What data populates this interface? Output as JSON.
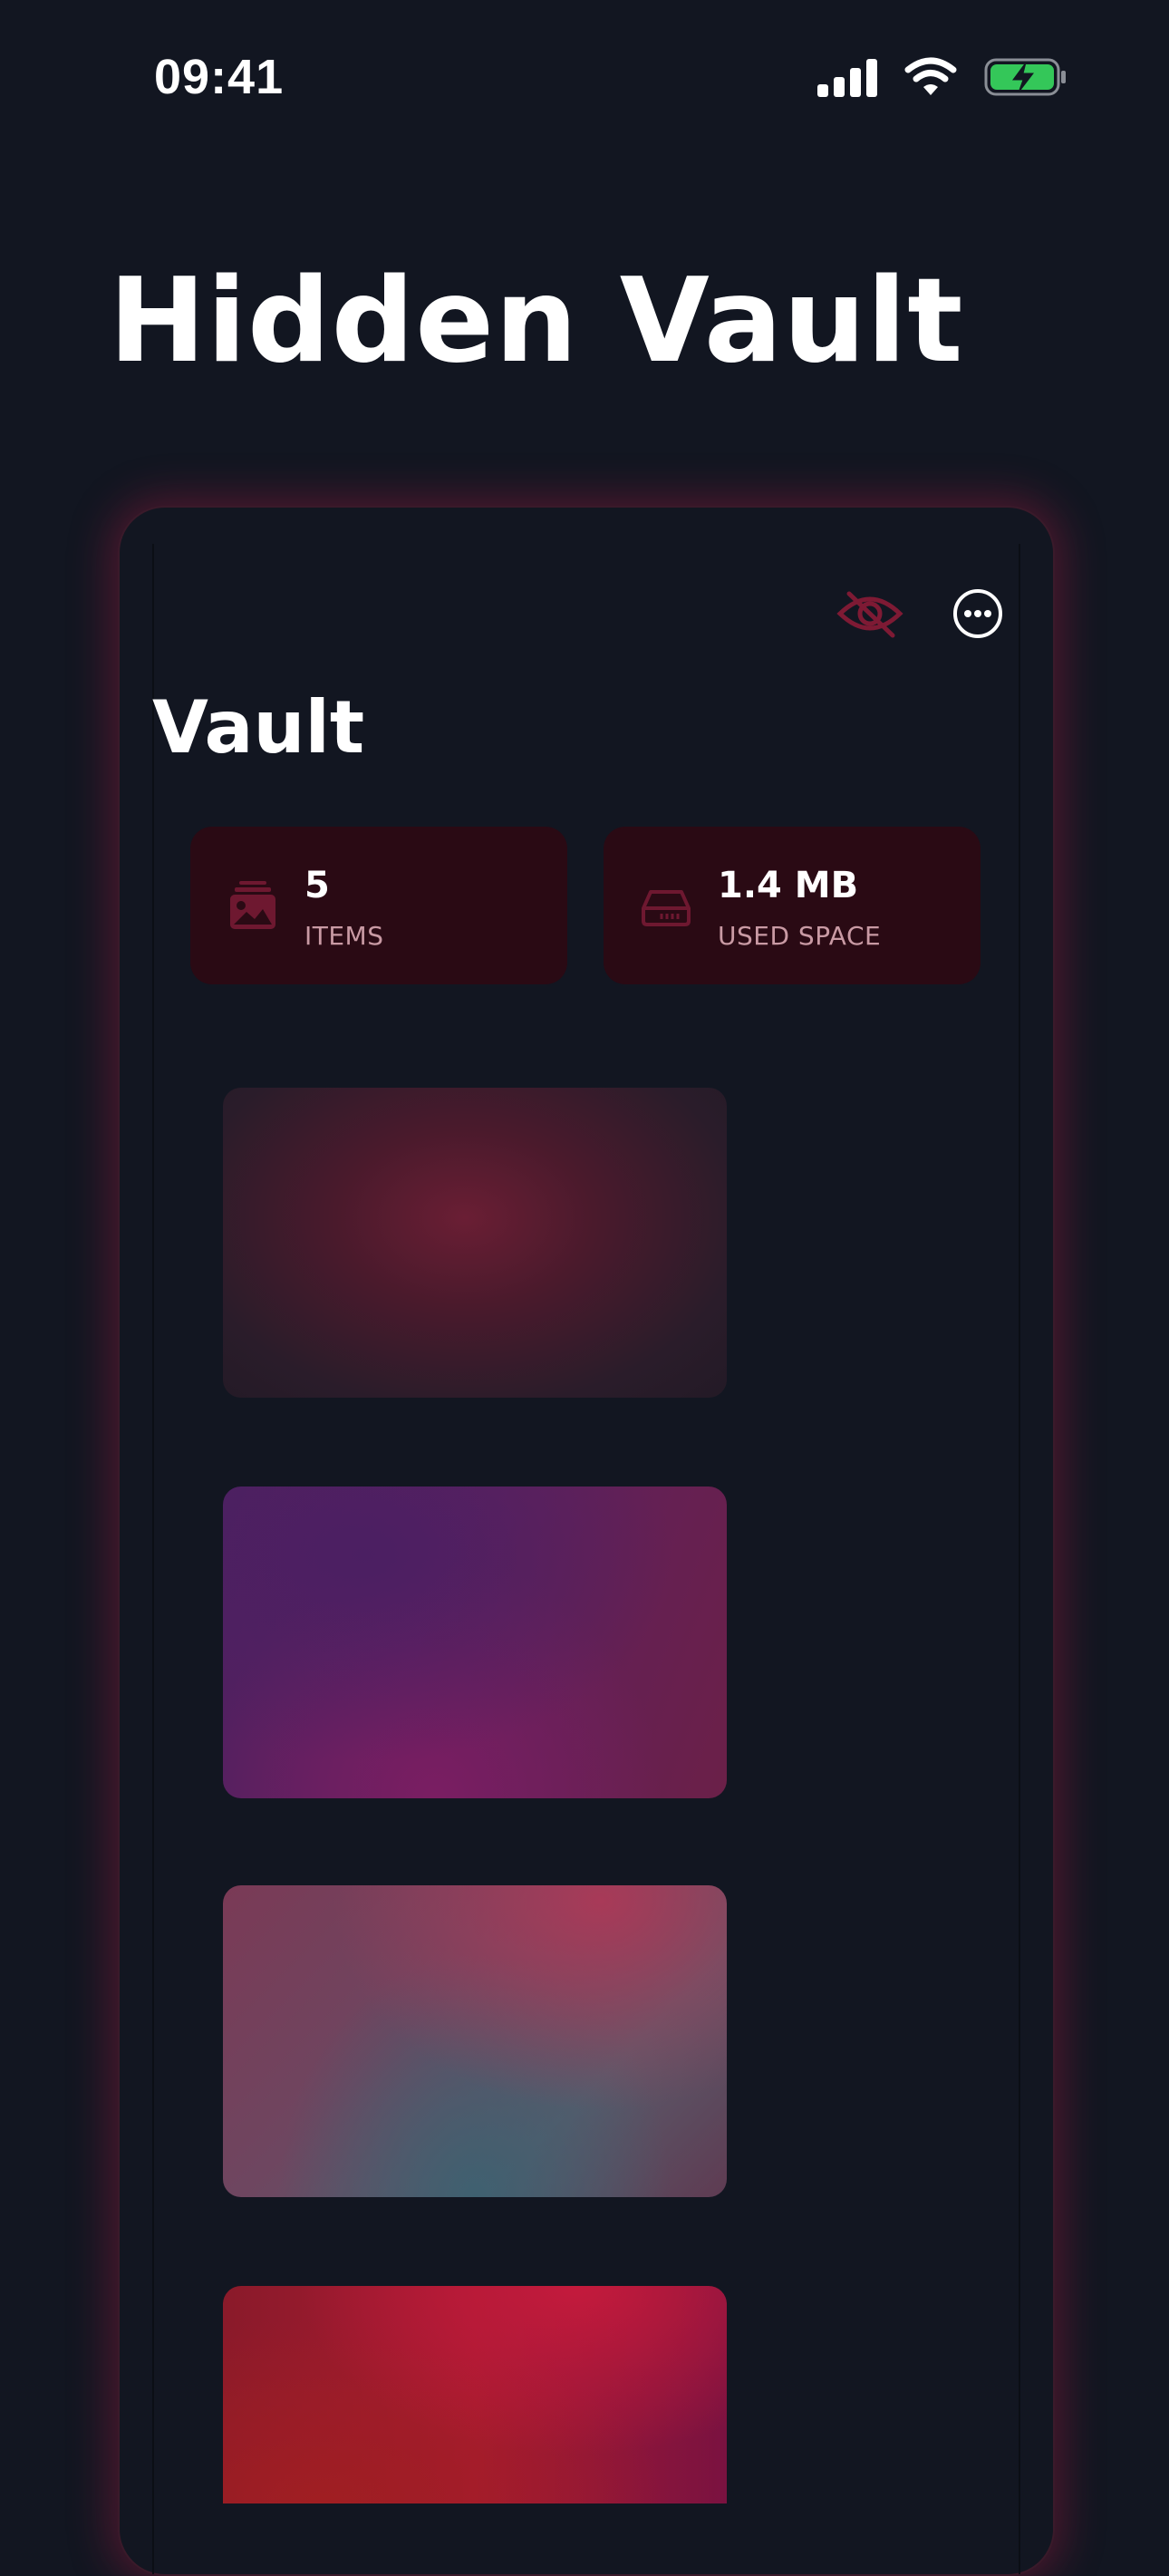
{
  "status_bar": {
    "time": "09:41"
  },
  "page": {
    "title": "Hidden Vault"
  },
  "vault": {
    "title": "Vault",
    "stats": {
      "items_value": "5",
      "items_label": "ITEMS",
      "space_value": "1.4 MB",
      "space_label": "USED SPACE"
    },
    "icons": {
      "hide": "eye-slash-icon",
      "more": "ellipsis-circle-icon",
      "items": "photo-stack-icon",
      "space": "drive-icon"
    },
    "thumbnails": [
      {
        "name": "media-thumbnail-1"
      },
      {
        "name": "media-thumbnail-2"
      },
      {
        "name": "media-thumbnail-3"
      },
      {
        "name": "media-thumbnail-4"
      }
    ]
  },
  "colors": {
    "background": "#121621",
    "accent": "#8a1a36",
    "card": "#2a0a14",
    "battery": "#34c759"
  }
}
